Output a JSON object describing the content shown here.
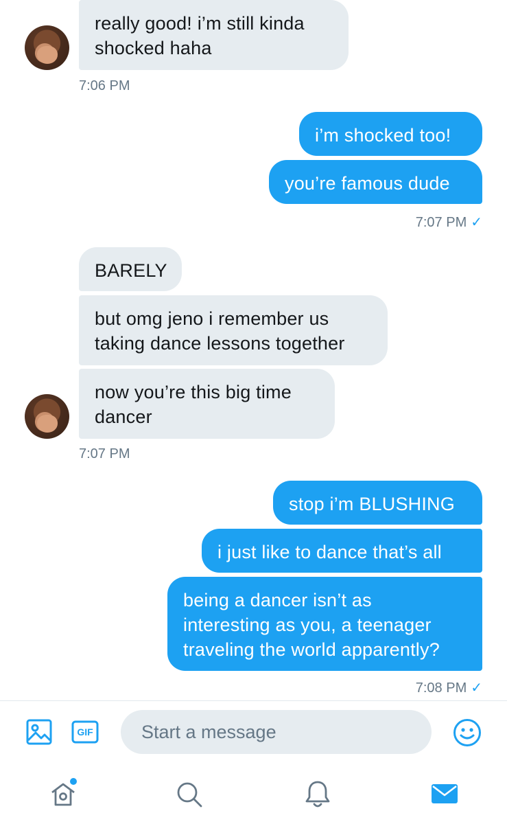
{
  "messages": [
    {
      "side": "in",
      "text": "really good! i’m still kinda\nshocked haha"
    },
    {
      "side": "out",
      "text": "i’m shocked too!"
    },
    {
      "side": "out",
      "text": "you’re famous dude"
    },
    {
      "side": "in",
      "text": "BARELY"
    },
    {
      "side": "in",
      "text": "but omg jeno i remember us\ntaking dance lessons together"
    },
    {
      "side": "in",
      "text": "now you’re this big time\ndancer"
    },
    {
      "side": "out",
      "text": "stop i’m BLUSHING"
    },
    {
      "side": "out",
      "text": "i just like to dance that’s all"
    },
    {
      "side": "out",
      "text": "being a dancer isn’t as\ninteresting as you, a teenager\ntraveling the world apparently?"
    }
  ],
  "timestamps": {
    "t1": "7:06 PM",
    "t2": "7:07 PM",
    "t3": "7:07 PM",
    "t4": "7:08 PM"
  },
  "read_receipt_icon": "checkmark-icon",
  "composer": {
    "placeholder": "Start a message",
    "gif_label": "GIF",
    "icons": [
      "image-icon",
      "gif-icon",
      "emoji-icon"
    ]
  },
  "tabbar": {
    "icons": [
      "home-icon",
      "search-icon",
      "notifications-bell-icon",
      "messages-envelope-icon"
    ],
    "active": "messages-envelope-icon",
    "home_has_notification_dot": true
  },
  "colors": {
    "accent": "#1da1f2",
    "incoming_bubble": "#e6ecf0",
    "timestamp": "#657786",
    "divider": "#e1e8ed",
    "tab_inactive": "#657786"
  }
}
